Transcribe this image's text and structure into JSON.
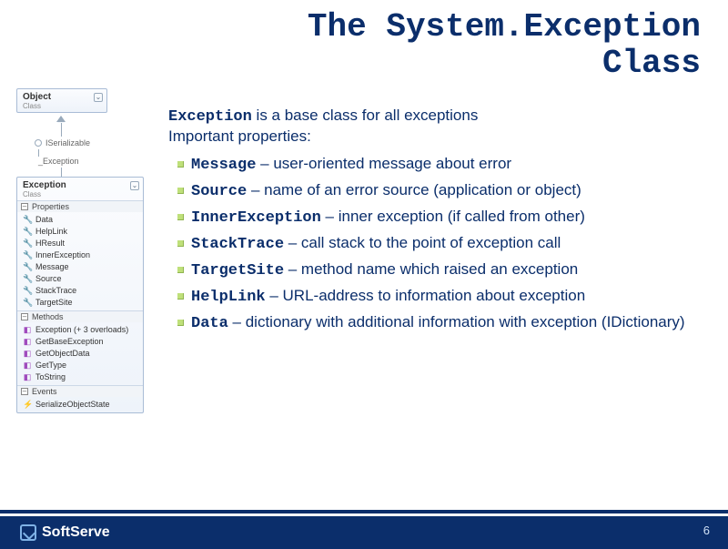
{
  "title": {
    "line1": "The System.Exception",
    "line2": "Class"
  },
  "diagram": {
    "object": {
      "name": "Object",
      "kind": "Class"
    },
    "interface": "ISerializable",
    "hidden": "_Exception",
    "exception": {
      "name": "Exception",
      "kind": "Class"
    },
    "sections": {
      "properties": "Properties",
      "methods": "Methods",
      "events": "Events"
    },
    "properties": [
      "Data",
      "HelpLink",
      "HResult",
      "InnerException",
      "Message",
      "Source",
      "StackTrace",
      "TargetSite"
    ],
    "methods": [
      "Exception (+ 3 overloads)",
      "GetBaseException",
      "GetObjectData",
      "GetType",
      "ToString"
    ],
    "events": [
      "SerializeObjectState"
    ]
  },
  "lead_bold": "Exception",
  "lead_rest": " is a base class for all exceptions",
  "sub": "Important properties:",
  "items": [
    {
      "name": "Message",
      "desc": " – user-oriented message about error"
    },
    {
      "name": "Source",
      "desc": " – name of an error source (application or object)"
    },
    {
      "name": "InnerException",
      "desc": " – inner exception (if called from other)"
    },
    {
      "name": "StackTrace",
      "desc": " – call stack to the point of exception call"
    },
    {
      "name": "TargetSite",
      "desc": " – method name which raised an exception"
    },
    {
      "name": "HelpLink",
      "desc": " – URL-address to information about exception"
    },
    {
      "name": "Data",
      "desc": " – dictionary with additional information with exception (IDictionary)"
    }
  ],
  "footer": {
    "brand": "SoftServe",
    "page": "6"
  }
}
